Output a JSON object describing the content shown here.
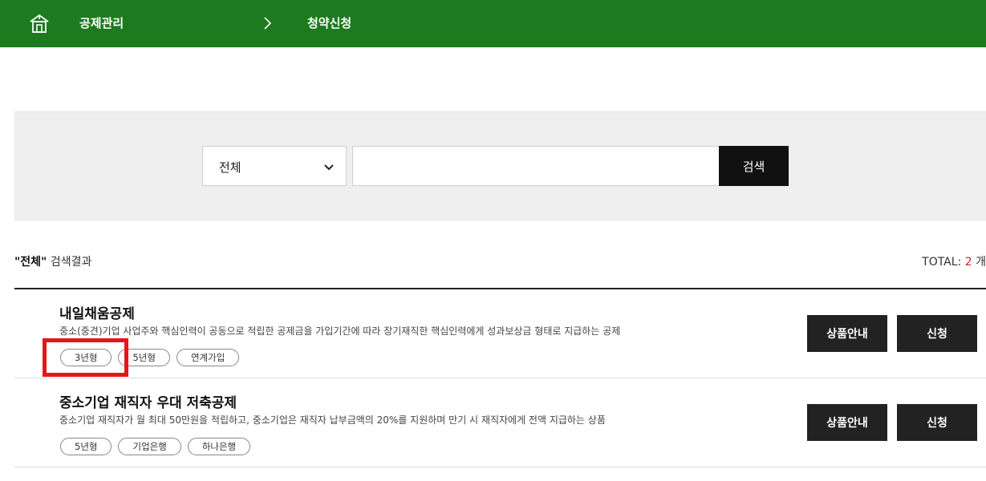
{
  "breadcrumb": {
    "home_icon": "home-icon",
    "level1": "공제관리",
    "separator_icon": "chevron-right-icon",
    "level2": "청약신청"
  },
  "search": {
    "category_selected": "전체",
    "input_value": "",
    "button_label": "검색"
  },
  "results": {
    "query_label": "\"전체\"",
    "suffix": "검색결과",
    "total_label": "TOTAL:",
    "total_count": "2",
    "total_unit": "개"
  },
  "items": [
    {
      "title": "내일채움공제",
      "description": "중소(중견)기업 사업주와 핵심인력이 공동으로 적립한 공제금을 가입기간에 따라 장기재직한 핵심인력에게 성과보상금 형태로 지급하는 공제",
      "tags": [
        "3년형",
        "5년형",
        "연계가입"
      ],
      "info_label": "상품안내",
      "apply_label": "신청"
    },
    {
      "title": "중소기업 재직자 우대 저축공제",
      "description": "중소기업 재직자가 월 최대 50만원을 적립하고, 중소기업은 재직자 납부금액의 20%를 지원하며 만기 시 재직자에게 전액 지급하는 상품",
      "tags": [
        "5년형",
        "기업은행",
        "하나은행"
      ],
      "info_label": "상품안내",
      "apply_label": "신청"
    }
  ],
  "colors": {
    "header_bg": "#1e7a1e",
    "button_bg": "#222222",
    "search_button_bg": "#111111",
    "total_count": "#d32020",
    "highlight": "#e4161b"
  }
}
